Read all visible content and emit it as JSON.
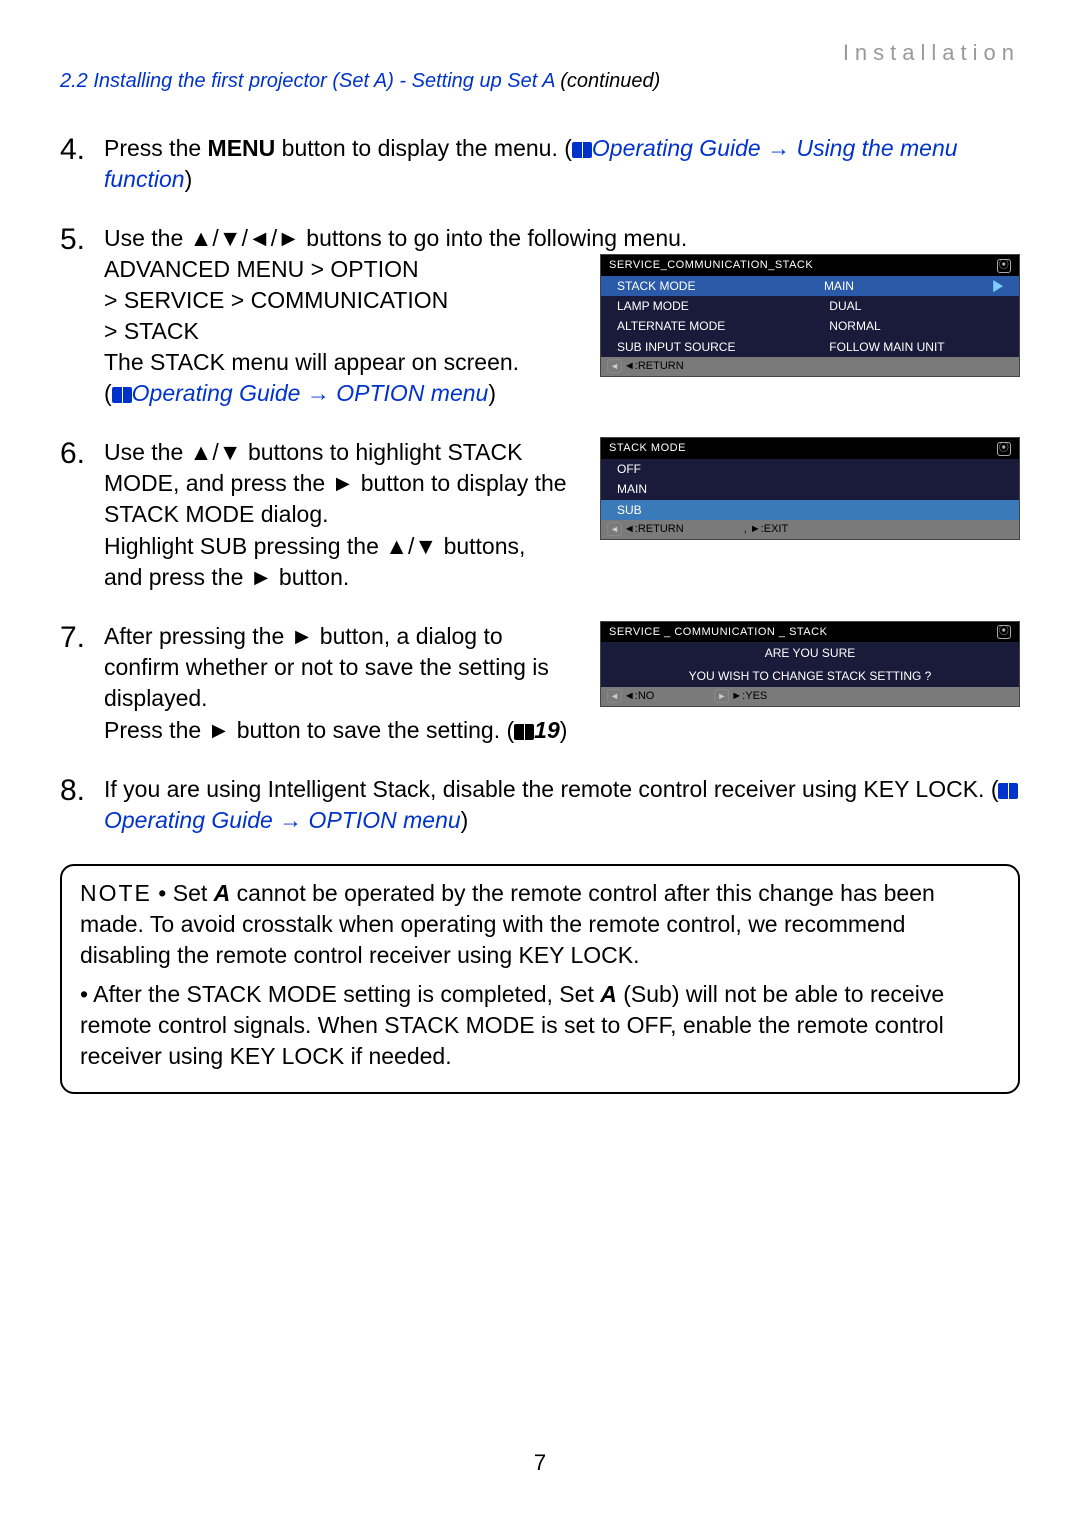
{
  "header": {
    "category": "Installation",
    "section": "2.2 Installing the first projector (Set A) - Setting up Set A",
    "continued": "(continued)"
  },
  "steps": {
    "s4": {
      "num": "4.",
      "pre": "Press the ",
      "menu": "MENU",
      "post": " button to display the menu. (",
      "ref": "Operating Guide → Using the menu function",
      "close": ")"
    },
    "s5": {
      "num": "5.",
      "line1": "Use the ▲/▼/◄/► buttons to go into the following menu.",
      "path1": "ADVANCED MENU > OPTION",
      "path2": "> SERVICE > COMMUNICATION",
      "path3": "> STACK",
      "line2": "The STACK menu will appear on screen.",
      "refOpen": "(",
      "ref": "Operating Guide → OPTION menu",
      "refClose": ")"
    },
    "s6": {
      "num": "6.",
      "text": "Use the ▲/▼ buttons to highlight STACK MODE, and press the ► button to display the STACK MODE dialog.\nHighlight SUB pressing the ▲/▼ buttons, and press the ► button."
    },
    "s7": {
      "num": "7.",
      "text1": "After pressing the ► button, a dialog to confirm whether or not to save the setting is displayed.",
      "text2a": "Press the ► button to save the setting. (",
      "text2page": "19",
      "text2b": ")"
    },
    "s8": {
      "num": "8.",
      "text1": "If you are using Intelligent Stack, disable the remote control receiver using KEY LOCK. (",
      "ref": "Operating Guide → OPTION menu",
      "close": ")"
    }
  },
  "osd1": {
    "title": "SERVICE_COMMUNICATION_STACK",
    "rows": [
      {
        "k": "STACK MODE",
        "v": "MAIN",
        "sel": true,
        "arrow": true
      },
      {
        "k": "LAMP MODE",
        "v": "DUAL"
      },
      {
        "k": "ALTERNATE MODE",
        "v": "NORMAL"
      },
      {
        "k": "SUB INPUT SOURCE",
        "v": "FOLLOW MAIN UNIT"
      }
    ],
    "footer": {
      "a": "◄:RETURN"
    }
  },
  "osd2": {
    "title": "STACK MODE",
    "rows": [
      {
        "k": "OFF"
      },
      {
        "k": "MAIN"
      },
      {
        "k": "SUB",
        "sel": true
      }
    ],
    "footer": {
      "a": "◄:RETURN",
      "b": ", ►:EXIT"
    }
  },
  "osd3": {
    "title": "SERVICE _ COMMUNICATION _ STACK",
    "line1": "ARE YOU SURE",
    "line2": "YOU WISH TO CHANGE STACK SETTING ?",
    "footer": {
      "a": "◄:NO",
      "b": "►:YES"
    }
  },
  "note": {
    "lead": "NOTE",
    "p1a": " • Set ",
    "p1b": "A",
    "p1c": " cannot be operated by the remote control after this change has been made. To avoid crosstalk when operating with the remote control,  we recommend disabling the remote control receiver using KEY LOCK.",
    "p2a": "• After the STACK MODE setting is completed, Set ",
    "p2b": "A",
    "p2c": " (Sub) will not be able to receive remote control signals. When STACK MODE is set to OFF, enable the remote control receiver using KEY LOCK if needed."
  },
  "pageNumber": "7"
}
